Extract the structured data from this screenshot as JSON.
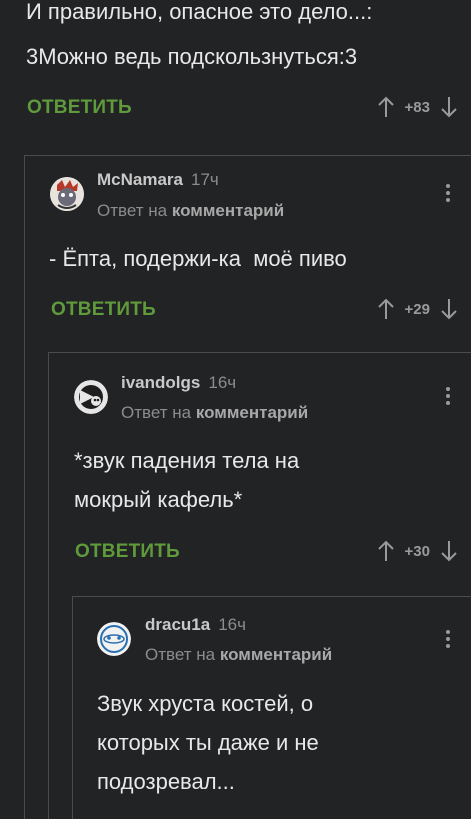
{
  "c0": {
    "text": [
      "И правильно, опасное это дело...:",
      "3Можно ведь подскользнуться:3"
    ],
    "reply": "ОТВЕТИТЬ",
    "votes": "+83"
  },
  "c1": {
    "author": "McNamara",
    "time": "17ч",
    "meta_prefix": "Ответ на",
    "meta_link": "комментарий",
    "text": [
      "- Ёпта, подержи-ка  моё пиво"
    ],
    "reply": "ОТВЕТИТЬ",
    "votes": "+29"
  },
  "c2": {
    "author": "ivandolgs",
    "time": "16ч",
    "meta_prefix": "Ответ на",
    "meta_link": "комментарий",
    "text": [
      "*звук падения тела на",
      "мокрый кафель*"
    ],
    "reply": "ОТВЕТИТЬ",
    "votes": "+30"
  },
  "c3": {
    "author": "dracu1a",
    "time": "16ч",
    "meta_prefix": "Ответ на",
    "meta_link": "комментарий",
    "text": [
      "Звук хруста костей, о",
      "которых ты даже и не",
      "подозревал..."
    ]
  },
  "icons": [
    "arrow-up-icon",
    "arrow-down-icon",
    "more-vertical-icon",
    "avatar"
  ],
  "colors": {
    "background": "#222325",
    "reply": "#5f9a3b",
    "thread_line": "#4a4b4d"
  }
}
